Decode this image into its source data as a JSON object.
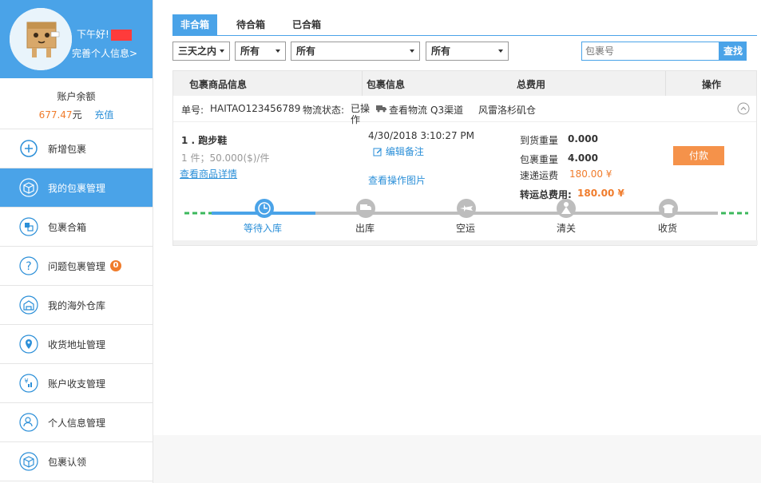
{
  "sidebar": {
    "greeting": "下午好!",
    "complete_info": "完善个人信息>",
    "balance_title": "账户余额",
    "balance_amount": "677.47",
    "balance_unit": "元",
    "recharge": "充值",
    "items": [
      {
        "label": "新增包裹",
        "icon": "plus-circle-icon"
      },
      {
        "label": "我的包裹管理",
        "icon": "package-box-icon"
      },
      {
        "label": "包裹合箱",
        "icon": "merge-boxes-icon"
      },
      {
        "label": "问题包裹管理",
        "icon": "question-icon",
        "badge": "0"
      },
      {
        "label": "我的海外仓库",
        "icon": "warehouse-icon"
      },
      {
        "label": "收货地址管理",
        "icon": "location-pin-icon"
      },
      {
        "label": "账户收支管理",
        "icon": "finance-icon"
      },
      {
        "label": "个人信息管理",
        "icon": "user-profile-icon"
      },
      {
        "label": "包裹认领",
        "icon": "claim-package-icon"
      }
    ]
  },
  "tabs": [
    "非合箱",
    "待合箱",
    "已合箱"
  ],
  "filters": {
    "time": "三天之内",
    "filter2": "所有",
    "filter3": "所有",
    "filter4": "所有"
  },
  "search": {
    "placeholder": "包裹号",
    "button": "查找"
  },
  "table": {
    "headers": [
      "包裹商品信息",
      "包裹信息",
      "总费用",
      "操作"
    ],
    "order": {
      "number_label": "单号:",
      "number": "HAITAO123456789",
      "status_label": "物流状态:",
      "status": "已操作",
      "track": "查看物流",
      "channel": "Q3渠道",
      "warehouse": "风雷洛杉矶仓"
    },
    "item": {
      "name": "1 . 跑步鞋",
      "qty_price": "1 件；50.000($)/件",
      "view_details": "查看商品详情",
      "date": "4/30/2018 3:10:27 PM",
      "edit_note": "编辑备注",
      "view_photos": "查看操作图片",
      "arrival_weight_label": "到货重量",
      "arrival_weight": "0.000",
      "package_weight_label": "包裹重量",
      "package_weight": "4.000",
      "express_fee_label": "速递运费",
      "express_fee": "180.00 ¥",
      "total_label": "转运总费用:",
      "total": "180.00 ¥",
      "pay": "付款"
    }
  },
  "progress": {
    "current_index": 0,
    "steps": [
      {
        "label": "等待入库",
        "icon": "clock-icon"
      },
      {
        "label": "出库",
        "icon": "truck-icon"
      },
      {
        "label": "空运",
        "icon": "airplane-icon"
      },
      {
        "label": "清关",
        "icon": "customs-icon"
      },
      {
        "label": "收货",
        "icon": "phone-icon"
      }
    ]
  },
  "colors": {
    "primary": "#4aa3e8",
    "accent_orange": "#f07c2c",
    "progress_green": "#3cb85c",
    "progress_gray": "#bdbdbd"
  }
}
